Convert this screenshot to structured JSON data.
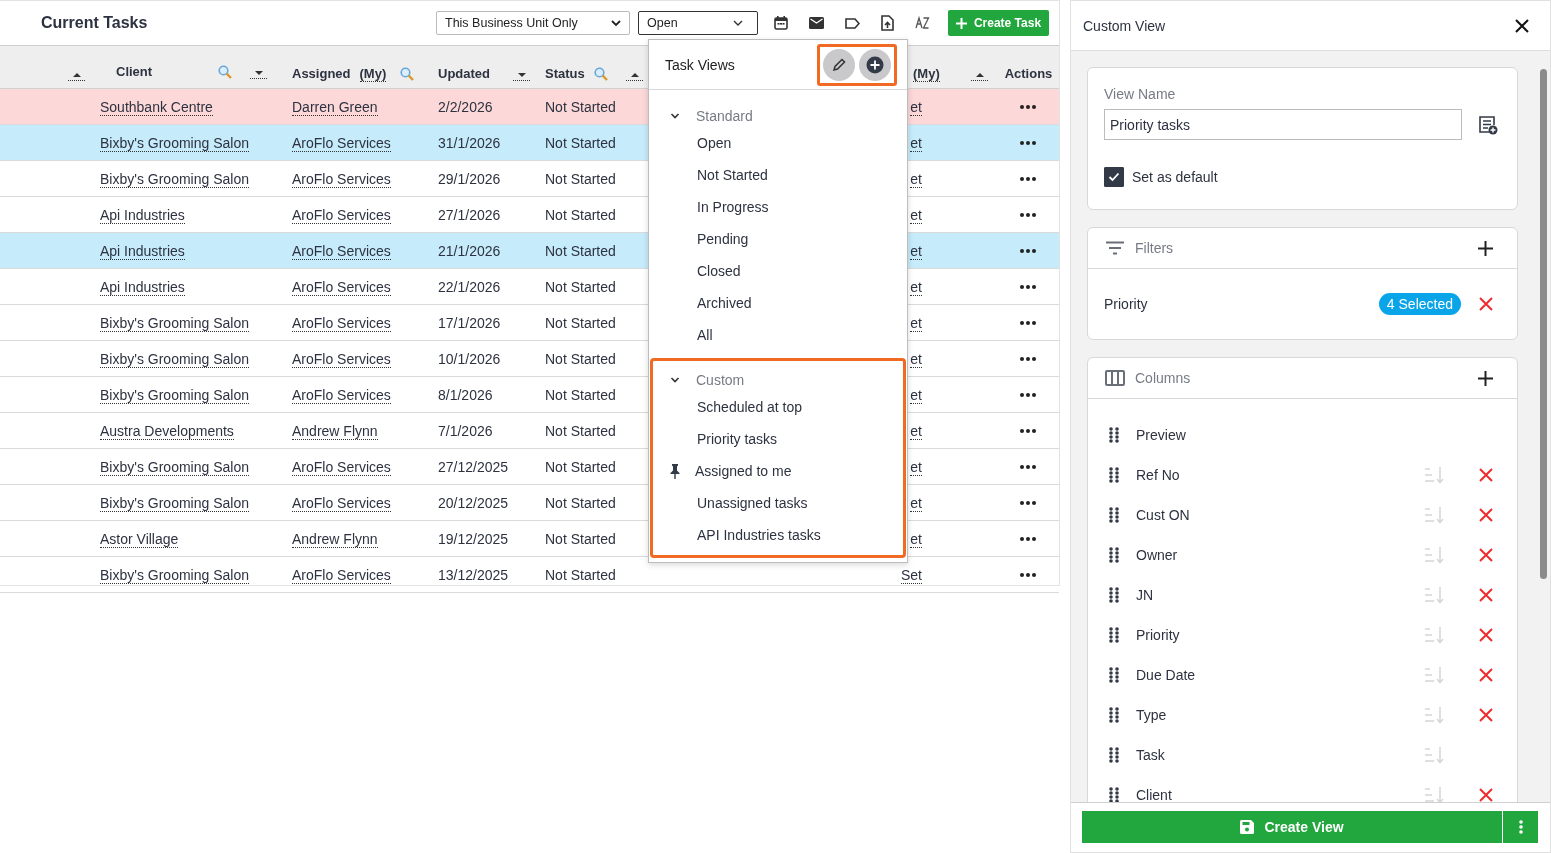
{
  "top_bar": {
    "title": "Current Tasks",
    "scope_select": "This Business Unit Only",
    "view_select": "Open",
    "create_button": "Create Task"
  },
  "table": {
    "header": [
      {
        "sort": {
          "ascending": true
        }
      },
      {
        "label": "Client",
        "search": true,
        "sort": {
          "ascending": false
        }
      },
      {
        "label": "Assigned",
        "suffix": "(My)",
        "search": true
      },
      {
        "label": "Updated",
        "sort": {
          "ascending": false
        }
      },
      {
        "label": "Status",
        "search": true,
        "sort": {
          "ascending": true
        }
      },
      {
        "suffix": "(My)",
        "sort": {
          "ascending": true
        }
      },
      {
        "label": "Actions"
      }
    ],
    "rows": [
      {
        "client": "Southbank Centre",
        "assigned": "Darren Green",
        "updated": "2/2/2026",
        "status": "Not Started",
        "column_6": "et",
        "selected": false,
        "overdue": true
      },
      {
        "client": "Bixby's Grooming Salon",
        "assigned": "AroFlo Services",
        "updated": "31/1/2026",
        "status": "Not Started",
        "column_6": "et",
        "selected": true,
        "overdue": false
      },
      {
        "client": "Bixby's Grooming Salon",
        "assigned": "AroFlo Services",
        "updated": "29/1/2026",
        "status": "Not Started",
        "column_6": "et",
        "selected": false,
        "overdue": false
      },
      {
        "client": "Api Industries",
        "assigned": "AroFlo Services",
        "updated": "27/1/2026",
        "status": "Not Started",
        "column_6": "et",
        "selected": false,
        "overdue": false
      },
      {
        "client": "Api Industries",
        "assigned": "AroFlo Services",
        "updated": "21/1/2026",
        "status": "Not Started",
        "column_6": "et",
        "selected": true,
        "overdue": false
      },
      {
        "client": "Api Industries",
        "assigned": "AroFlo Services",
        "updated": "22/1/2026",
        "status": "Not Started",
        "column_6": "et",
        "selected": false,
        "overdue": false
      },
      {
        "client": "Bixby's Grooming Salon",
        "assigned": "AroFlo Services",
        "updated": "17/1/2026",
        "status": "Not Started",
        "column_6": "et",
        "selected": false,
        "overdue": false
      },
      {
        "client": "Bixby's Grooming Salon",
        "assigned": "AroFlo Services",
        "updated": "10/1/2026",
        "status": "Not Started",
        "column_6": "et",
        "selected": false,
        "overdue": false
      },
      {
        "client": "Bixby's Grooming Salon",
        "assigned": "AroFlo Services",
        "updated": "8/1/2026",
        "status": "Not Started",
        "column_6": "et",
        "selected": false,
        "overdue": false
      },
      {
        "client": "Austra Developments",
        "assigned": "Andrew Flynn",
        "updated": "7/1/2026",
        "status": "Not Started",
        "column_6": "et",
        "selected": false,
        "overdue": false
      },
      {
        "client": "Bixby's Grooming Salon",
        "assigned": "AroFlo Services",
        "updated": "27/12/2025",
        "status": "Not Started",
        "column_6": "et",
        "selected": false,
        "overdue": false
      },
      {
        "client": "Bixby's Grooming Salon",
        "assigned": "AroFlo Services",
        "updated": "20/12/2025",
        "status": "Not Started",
        "column_6": "et",
        "selected": false,
        "overdue": false
      },
      {
        "client": "Astor Village",
        "assigned": "Andrew Flynn",
        "updated": "19/12/2025",
        "status": "Not Started",
        "column_6": "et",
        "selected": false,
        "overdue": false
      },
      {
        "client": "Bixby's Grooming Salon",
        "assigned": "AroFlo Services",
        "updated": "13/12/2025",
        "status": "Not Started",
        "column_6": "Set",
        "selected": false,
        "overdue": false
      }
    ]
  },
  "task_views": {
    "title": "Task Views",
    "actions_highlighted": true,
    "groups": [
      {
        "label": "Standard",
        "expanded": true,
        "highlighted": false,
        "items": [
          {
            "label": "Open",
            "pinned": false
          },
          {
            "label": "Not Started",
            "pinned": false
          },
          {
            "label": "In Progress",
            "pinned": false
          },
          {
            "label": "Pending",
            "pinned": false
          },
          {
            "label": "Closed",
            "pinned": false
          },
          {
            "label": "Archived",
            "pinned": false
          },
          {
            "label": "All",
            "pinned": false
          }
        ]
      },
      {
        "label": "Custom",
        "expanded": true,
        "highlighted": true,
        "items": [
          {
            "label": "Scheduled at top",
            "pinned": false
          },
          {
            "label": "Priority tasks",
            "pinned": false
          },
          {
            "label": "Assigned to me",
            "pinned": true
          },
          {
            "label": "Unassigned tasks",
            "pinned": false
          },
          {
            "label": "API Industries tasks",
            "pinned": false
          }
        ]
      }
    ]
  },
  "custom_view": {
    "title": "Custom View",
    "view_name_label": "View Name",
    "view_name": "Priority tasks",
    "set_default": {
      "label": "Set as default",
      "checked": true
    },
    "filters": {
      "title": "Filters",
      "items": [
        {
          "name": "Priority",
          "badge": "4 Selected"
        }
      ]
    },
    "columns": {
      "title": "Columns",
      "items": [
        {
          "name": "Preview",
          "sortable": false,
          "removable": false
        },
        {
          "name": "Ref No",
          "sortable": true,
          "removable": true
        },
        {
          "name": "Cust ON",
          "sortable": true,
          "removable": true
        },
        {
          "name": "Owner",
          "sortable": true,
          "removable": true
        },
        {
          "name": "JN",
          "sortable": true,
          "removable": true
        },
        {
          "name": "Priority",
          "sortable": true,
          "removable": true
        },
        {
          "name": "Due Date",
          "sortable": true,
          "removable": true
        },
        {
          "name": "Type",
          "sortable": true,
          "removable": true
        },
        {
          "name": "Task",
          "sortable": true,
          "removable": false
        },
        {
          "name": "Client",
          "sortable": true,
          "removable": true
        }
      ]
    },
    "create_button": "Create View"
  }
}
